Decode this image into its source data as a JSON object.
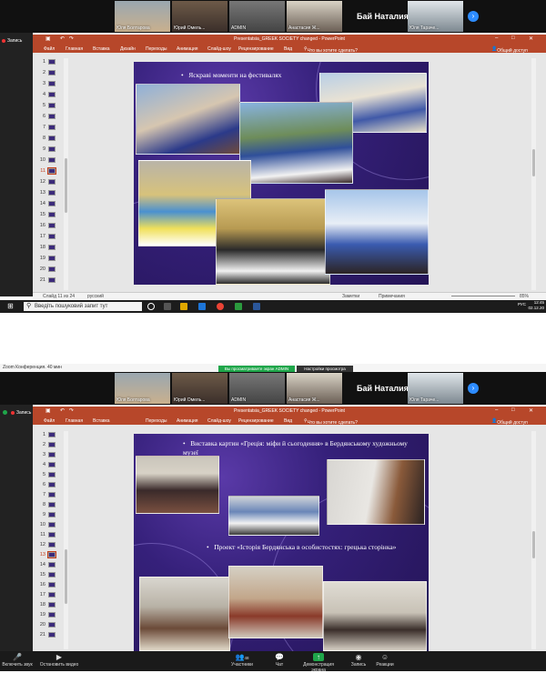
{
  "top": {
    "participants": [
      {
        "name": "Юля Болтарова"
      },
      {
        "name": "Юрий Омель..."
      },
      {
        "name": "ADMIN"
      },
      {
        "name": "Анастасия Ж..."
      },
      {
        "name": "Юля Тараче..."
      }
    ],
    "speaker": "Бай Наталия",
    "recording": "Запись",
    "ppt": {
      "filename": "Presentatsia_GREEK SOCIETY changed - PowerPoint",
      "tabs": [
        "Файл",
        "Главная",
        "Вставка",
        "Дизайн",
        "Переходы",
        "Анимация",
        "Слайд-шоу",
        "Рецензирование",
        "Вид"
      ],
      "tell_me": "Что вы хотите сделать?",
      "share": "Общий доступ",
      "thumb_numbers": [
        "1",
        "2",
        "3",
        "4",
        "5",
        "6",
        "7",
        "8",
        "9",
        "10",
        "11",
        "12",
        "13",
        "14",
        "15",
        "16",
        "17",
        "18",
        "19",
        "20",
        "21"
      ],
      "selected_slide": "11"
    },
    "slide": {
      "bullet": "Яскраві моменти на фестивалях"
    },
    "status": {
      "slide_of": "Слайд 11 из 24",
      "language": "русский",
      "notes": "Заметки",
      "comments": "Примечания",
      "zoom": "85%"
    },
    "taskbar": {
      "search_placeholder": "Введіть пошуковий запит тут",
      "time": "12:45",
      "date": "02.12.20",
      "lang": "РУС"
    }
  },
  "bottom": {
    "zoom_title": "Zoom Конференция. 40 мин",
    "share_banner": "Вы просматриваете экран ADMIN",
    "view_options": "Настройки просмотра",
    "participants": [
      {
        "name": "Юля Болтарова"
      },
      {
        "name": "Юрий Омель..."
      },
      {
        "name": "ADMIN"
      },
      {
        "name": "Анастасия Ж..."
      },
      {
        "name": "Юля Тараче..."
      }
    ],
    "speaker": "Бай Наталия",
    "recording": "Запись",
    "ppt": {
      "filename": "Presentatsia_GREEK SOCIETY changed - PowerPoint",
      "tabs": [
        "Файл",
        "Главная",
        "Вставка",
        "Переходы",
        "Анимация",
        "Слайд-шоу",
        "Рецензирование",
        "Вид"
      ],
      "tell_me": "Что вы хотите сделать?",
      "share": "Общий доступ",
      "thumb_numbers": [
        "1",
        "2",
        "3",
        "4",
        "5",
        "6",
        "7",
        "8",
        "9",
        "10",
        "11",
        "12",
        "13",
        "14",
        "15",
        "16",
        "17",
        "18",
        "19",
        "20",
        "21"
      ],
      "selected_slide": "13"
    },
    "slide": {
      "bullet1": "Виставка картин «Греція: міфи й сьогодення» в Бердянському художньому музеї",
      "bullet2": "Проект «Історія Бердянська в особистостях: грецька сторінка»"
    },
    "toolbar": {
      "audio": "Включить звук",
      "video": "Остановить видео",
      "participants": "Участники",
      "participants_count": "48",
      "chat": "Чат",
      "share": "Демонстрация экрана",
      "record": "Запись",
      "reactions": "Реакции"
    }
  }
}
